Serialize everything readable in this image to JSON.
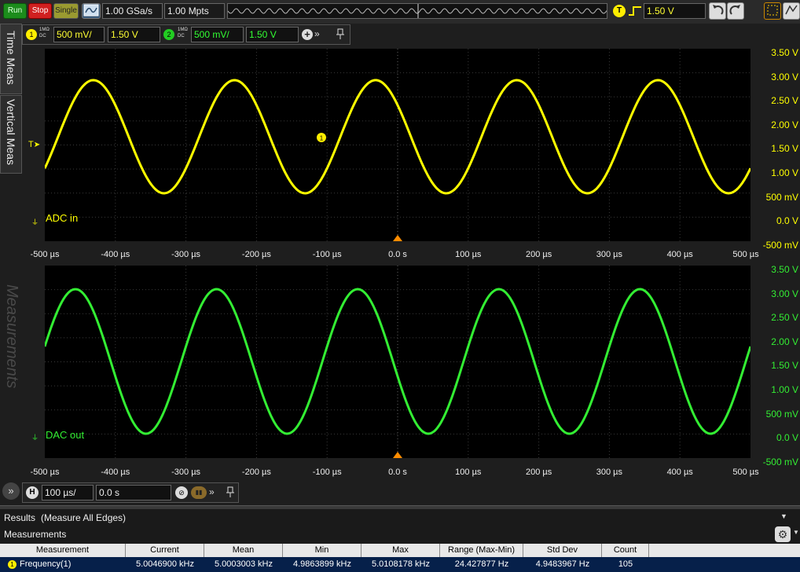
{
  "toolbar": {
    "run": "Run",
    "stop": "Stop",
    "single": "Single",
    "sample_rate": "1.00 GSa/s",
    "memory_depth": "1.00 Mpts",
    "trigger_level": "1.50 V",
    "trigger_badge": "T"
  },
  "channels": [
    {
      "num": "1",
      "coupling_top": "1MΩ",
      "coupling_bottom": "DC",
      "scale": "500 mV/",
      "offset": "1.50 V"
    },
    {
      "num": "2",
      "coupling_top": "1MΩ",
      "coupling_bottom": "DC",
      "scale": "500 mV/",
      "offset": "1.50 V"
    }
  ],
  "side_tabs": {
    "time_meas": "Time Meas",
    "vertical_meas": "Vertical Meas",
    "measurements": "Measurements"
  },
  "plot1": {
    "trace_label": "ADC in",
    "channel_marker": "1",
    "trigger_marker": "T",
    "color": "#ffff00",
    "y_ticks": [
      "3.50 V",
      "3.00 V",
      "2.50 V",
      "2.00 V",
      "1.50 V",
      "1.00 V",
      "500 mV",
      "0.0 V",
      "-500 mV"
    ]
  },
  "plot2": {
    "trace_label": "DAC out",
    "channel_marker": "2",
    "color": "#33ee33",
    "y_ticks": [
      "3.50 V",
      "3.00 V",
      "2.50 V",
      "2.00 V",
      "1.50 V",
      "1.00 V",
      "500 mV",
      "0.0 V",
      "-500 mV"
    ]
  },
  "x_ticks": [
    "-500 µs",
    "-400 µs",
    "-300 µs",
    "-200 µs",
    "-100 µs",
    "0.0 s",
    "100 µs",
    "200 µs",
    "300 µs",
    "400 µs",
    "500 µs"
  ],
  "timebase": {
    "badge": "H",
    "scale": "100 µs/",
    "delay": "0.0 s"
  },
  "results": {
    "title": "Results",
    "subtitle": "(Measure All Edges)",
    "section": "Measurements",
    "headers": [
      "Measurement",
      "Current",
      "Mean",
      "Min",
      "Max",
      "Range (Max-Min)",
      "Std Dev",
      "Count"
    ],
    "rows": [
      {
        "badge": "1",
        "cells": [
          "Frequency(1)",
          "5.0046900 kHz",
          "5.0003003 kHz",
          "4.9863899 kHz",
          "5.0108178 kHz",
          "24.427877 Hz",
          "4.9483967 Hz",
          "105"
        ]
      }
    ]
  },
  "colors": {
    "ch1": "#ffff00",
    "ch2": "#33ee33",
    "run": "#1c8c1c",
    "stop": "#c81e1e",
    "single": "#a0a030",
    "trigger": "#ff8c00"
  }
}
